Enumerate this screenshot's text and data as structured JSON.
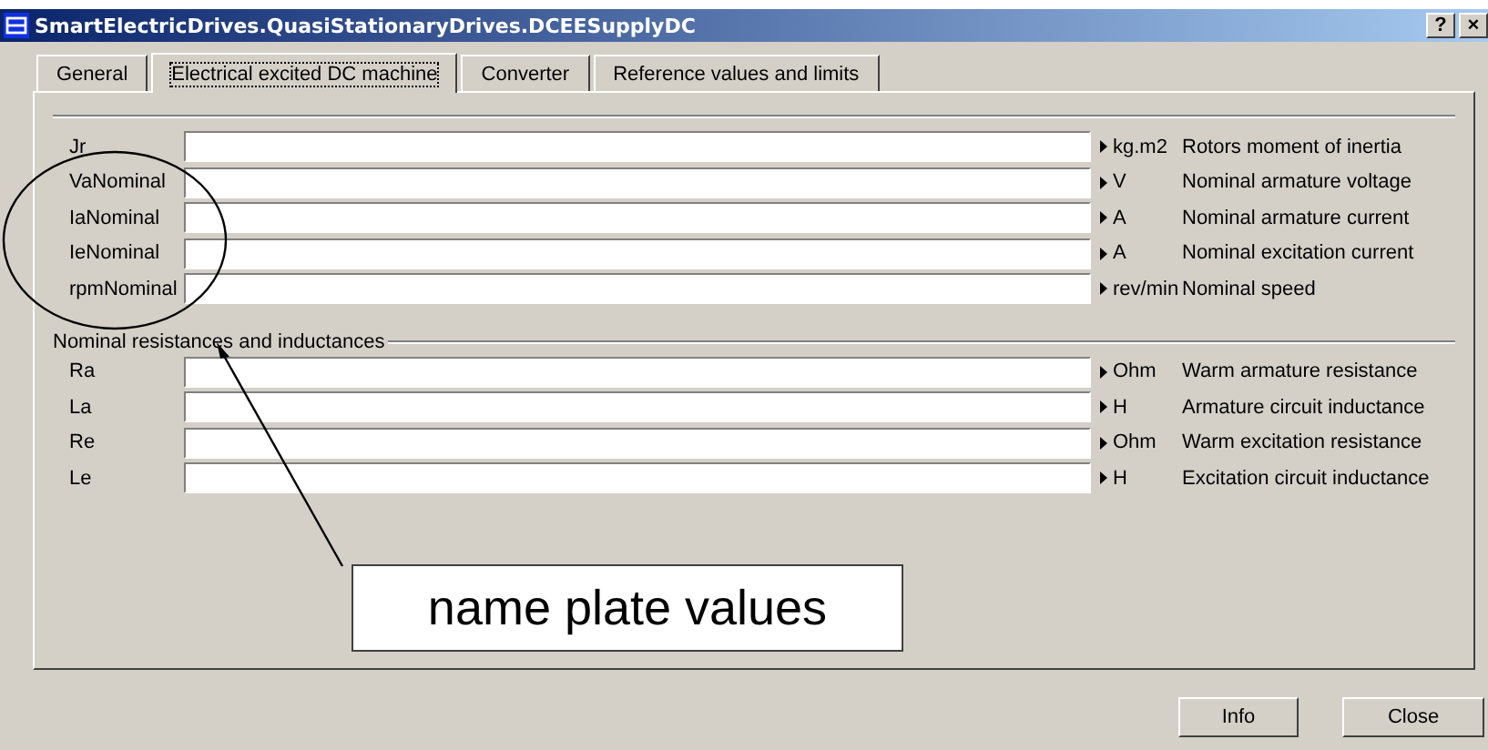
{
  "window": {
    "title": "SmartElectricDrives.QuasiStationaryDrives.DCEESupplyDC",
    "title_buttons": [
      "?",
      "×"
    ]
  },
  "tabs": [
    {
      "label": "General",
      "selected": false
    },
    {
      "label": "Electrical excited DC machine",
      "selected": true
    },
    {
      "label": "Converter",
      "selected": false
    },
    {
      "label": "Reference values and limits",
      "selected": false
    }
  ],
  "groups": [
    {
      "parameters": [
        {
          "name": "Jr",
          "unit": "kg.m2",
          "description": "Rotors moment of inertia"
        },
        {
          "name": "VaNominal",
          "unit": "V",
          "description": "Nominal armature voltage"
        },
        {
          "name": "IaNominal",
          "unit": "A",
          "description": "Nominal armature current"
        },
        {
          "name": "IeNominal",
          "unit": "A",
          "description": "Nominal excitation current"
        },
        {
          "name": "rpmNominal",
          "unit": "rev/min",
          "description": "Nominal speed"
        }
      ]
    },
    {
      "title": "Nominal resistances and inductances",
      "parameters": [
        {
          "name": "Ra",
          "unit": "Ohm",
          "description": "Warm armature resistance"
        },
        {
          "name": "La",
          "unit": "H",
          "description": "Armature circuit inductance"
        },
        {
          "name": "Re",
          "unit": "Ohm",
          "description": "Warm excitation resistance"
        },
        {
          "name": "Le",
          "unit": "H",
          "description": "Excitation circuit inductance"
        }
      ]
    }
  ],
  "annotation": {
    "text": "name plate values"
  },
  "buttons": [
    "Info",
    "Close"
  ]
}
